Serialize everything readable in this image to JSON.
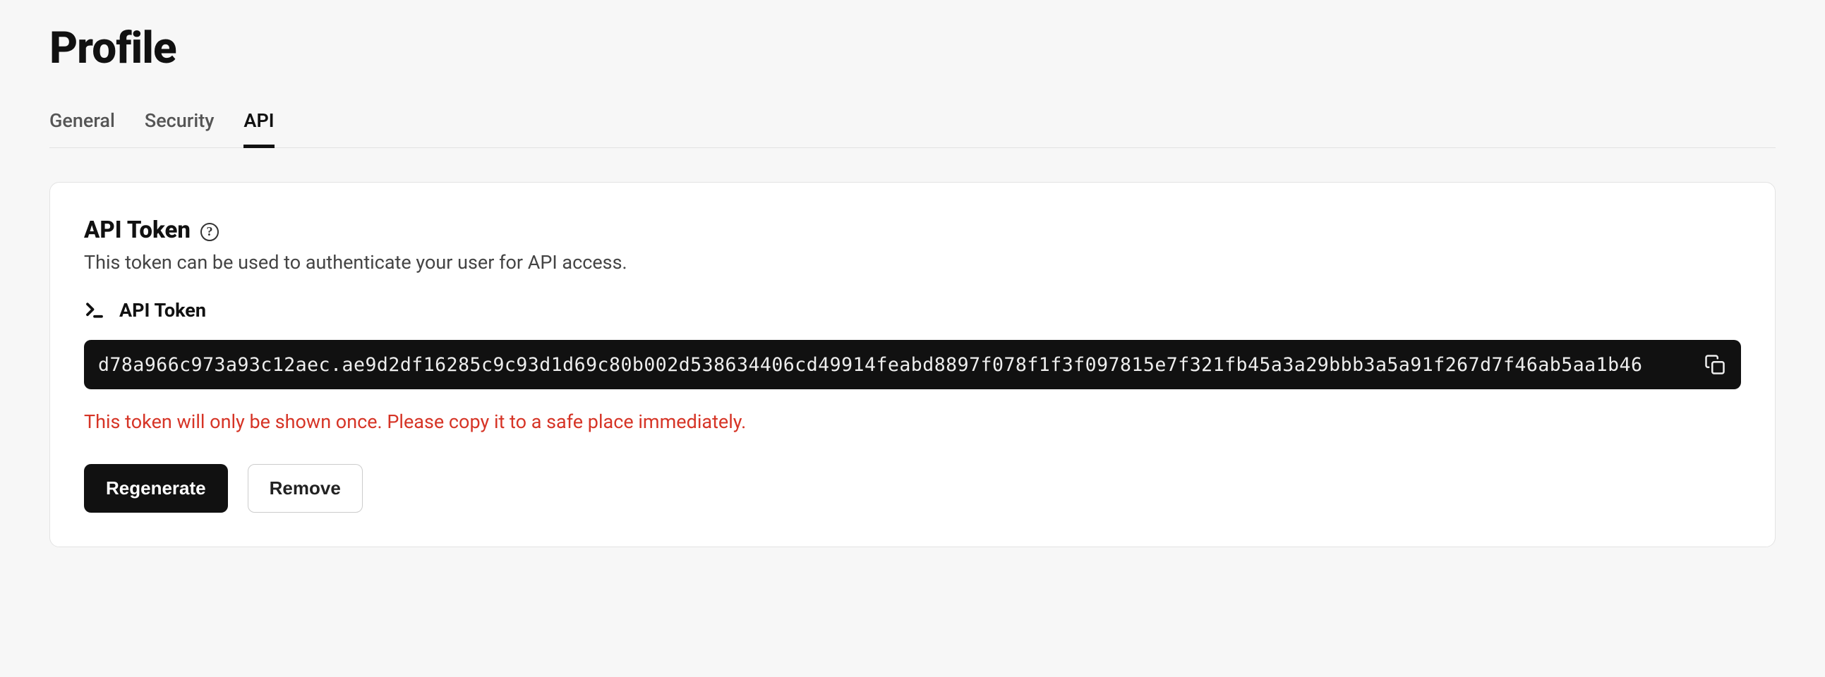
{
  "header": {
    "title": "Profile"
  },
  "tabs": [
    {
      "label": "General",
      "active": false
    },
    {
      "label": "Security",
      "active": false
    },
    {
      "label": "API",
      "active": true
    }
  ],
  "card": {
    "title": "API Token",
    "help_glyph": "?",
    "description": "This token can be used to authenticate your user for API access.",
    "token_label": "API Token",
    "token_value": "d78a966c973a93c12aec.ae9d2df16285c9c93d1d69c80b002d538634406cd49914feabd8897f078f1f3f097815e7f321fb45a3a29bbb3a5a91f267d7f46ab5aa1b46",
    "warning": "This token will only be shown once. Please copy it to a safe place immediately.",
    "buttons": {
      "regenerate": "Regenerate",
      "remove": "Remove"
    }
  }
}
